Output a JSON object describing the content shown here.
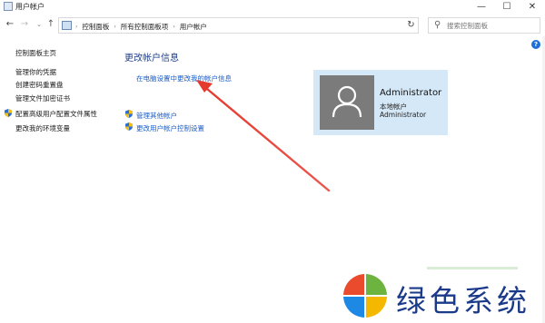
{
  "window": {
    "title": "用户帐户",
    "minimize": "—",
    "maximize": "☐",
    "close": "✕"
  },
  "nav": {
    "back": "←",
    "forward": "→",
    "recent": "⌄",
    "up": "↑",
    "breadcrumbs": [
      "控制面板",
      "所有控制面板项",
      "用户帐户"
    ],
    "refresh": "↻",
    "search_placeholder": "搜索控制面板"
  },
  "help": "?",
  "sidebar": {
    "home": "控制面板主页",
    "items": [
      {
        "label": "管理你的凭据",
        "icon": ""
      },
      {
        "label": "创建密码重置盘",
        "icon": ""
      },
      {
        "label": "管理文件加密证书",
        "icon": ""
      },
      {
        "label": "配置高级用户配置文件属性",
        "icon": "shield-icon"
      },
      {
        "label": "更改我的环境变量",
        "icon": ""
      }
    ]
  },
  "main": {
    "heading": "更改帐户信息",
    "change_in_pc_settings": "在电脑设置中更改我的帐户信息",
    "manage_other": "管理其他帐户",
    "uac_settings": "更改用户帐户控制设置"
  },
  "account": {
    "name": "Administrator",
    "type": "本地帐户",
    "username": "Administrator",
    "card_color": "#d5e8f7"
  },
  "watermark": {
    "text": "绿色系统",
    "colors": [
      "#e94b2c",
      "#6cb33f",
      "#1e88e5",
      "#f5b800"
    ]
  },
  "annotation": {
    "arrow_color": "#e53a2f"
  }
}
